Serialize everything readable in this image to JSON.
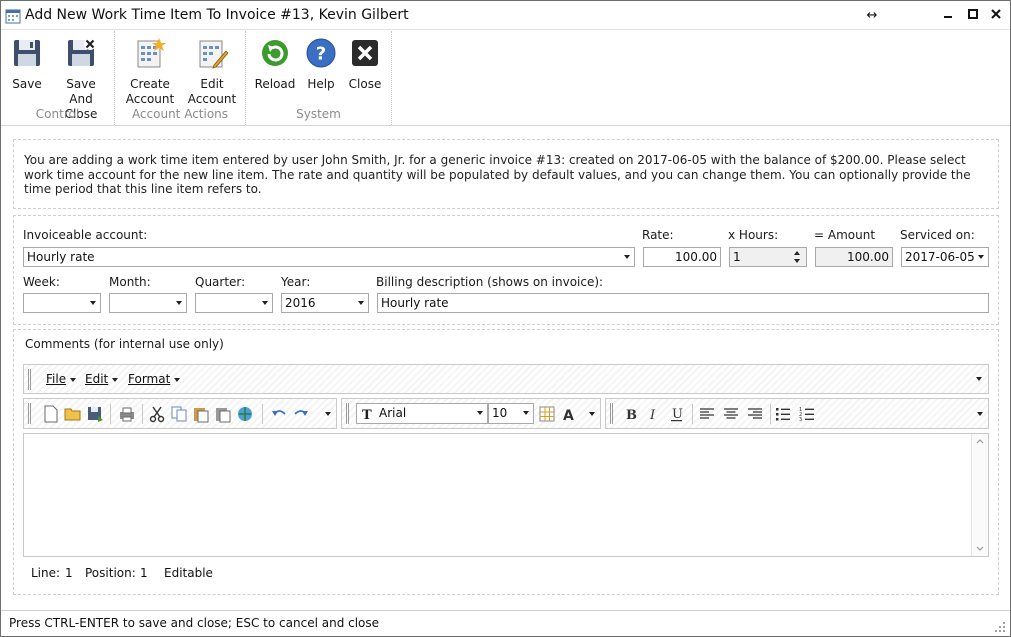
{
  "window": {
    "title": "Add New Work Time Item To Invoice #13, Kevin Gilbert"
  },
  "ribbon": {
    "groups": [
      {
        "label": "Control",
        "buttons": [
          "Save",
          "Save And Close"
        ]
      },
      {
        "label": "Account Actions",
        "buttons": [
          "Create Account",
          "Edit Account"
        ]
      },
      {
        "label": "System",
        "buttons": [
          "Reload",
          "Help",
          "Close"
        ]
      }
    ],
    "save": {
      "l1": "Save",
      "l2": ""
    },
    "save_close": {
      "l1": "Save And",
      "l2": "Close"
    },
    "create_account": {
      "l1": "Create",
      "l2": "Account"
    },
    "edit_account": {
      "l1": "Edit",
      "l2": "Account"
    },
    "reload": "Reload",
    "help": "Help",
    "close": "Close",
    "group_control": "Control",
    "group_account": "Account Actions",
    "group_system": "System"
  },
  "info": {
    "text": "You are adding a work time item entered by user John Smith, Jr. for a generic invoice #13: created on 2017-06-05 with the balance of $200.00. Please select work time account for the new line item. The rate and quantity will be populated by default values, and you can change them. You can optionally provide the time period that this line item refers to."
  },
  "form": {
    "account_label": "Invoiceable account:",
    "account_value": "Hourly rate",
    "rate_label": "Rate:",
    "rate_value": "100.00",
    "hours_label": "x Hours:",
    "hours_value": "1",
    "amount_label": "= Amount",
    "amount_value": "100.00",
    "serviced_label": "Serviced on:",
    "serviced_value": "2017-06-05",
    "week_label": "Week:",
    "week_value": "",
    "month_label": "Month:",
    "month_value": "",
    "quarter_label": "Quarter:",
    "quarter_value": "",
    "year_label": "Year:",
    "year_value": "2016",
    "billing_label": "Billing description (shows on invoice):",
    "billing_value": "Hourly rate"
  },
  "comments": {
    "label": "Comments (for internal use only)",
    "menu": {
      "file": "File",
      "edit": "Edit",
      "format": "Format"
    },
    "font_family": "Arial",
    "font_size": "10",
    "text": "",
    "status": {
      "line_label": "Line:",
      "line_value": "1",
      "position_label": "Position:",
      "position_value": "1",
      "mode": "Editable"
    }
  },
  "footer": {
    "hint": "Press CTRL-ENTER to save and close; ESC to cancel and close"
  },
  "colors": {
    "help_blue": "#3a6fc4",
    "reload_green": "#3c9a2e",
    "close_dark": "#2b2b2b"
  }
}
